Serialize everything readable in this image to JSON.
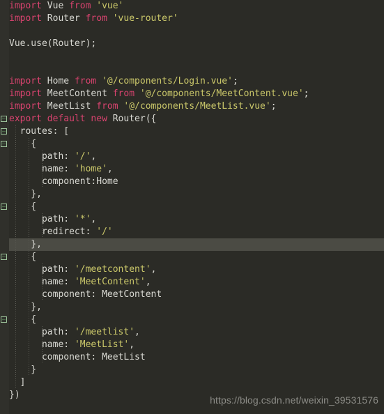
{
  "editor": {
    "background_color": "#2b2b26",
    "gutter_color": "#30302b",
    "current_line_color": "#4b4b44",
    "font_size_px": 13,
    "line_height_px": 18,
    "colors": {
      "keyword": "#d9436f",
      "identifier": "#d8d8d2",
      "string": "#cbc86a",
      "punctuation": "#d8d8d2",
      "fold_marker_border": "#9ec49b",
      "indent_guide": "#5c5c54"
    }
  },
  "watermark": {
    "text": "https://blog.csdn.net/weixin_39531576"
  },
  "current_line_number": 20,
  "fold_marker_lines": [
    10,
    11,
    12,
    17,
    21,
    26
  ],
  "code_lines": [
    {
      "n": 1,
      "indent_guides": [],
      "tokens": [
        {
          "t": "import",
          "c": "key"
        },
        {
          "t": " ",
          "c": "punc"
        },
        {
          "t": "Vue",
          "c": "id"
        },
        {
          "t": " ",
          "c": "punc"
        },
        {
          "t": "from",
          "c": "key"
        },
        {
          "t": " ",
          "c": "punc"
        },
        {
          "t": "'vue'",
          "c": "str"
        }
      ]
    },
    {
      "n": 2,
      "indent_guides": [],
      "tokens": [
        {
          "t": "import",
          "c": "key"
        },
        {
          "t": " ",
          "c": "punc"
        },
        {
          "t": "Router",
          "c": "id"
        },
        {
          "t": " ",
          "c": "punc"
        },
        {
          "t": "from",
          "c": "key"
        },
        {
          "t": " ",
          "c": "punc"
        },
        {
          "t": "'vue-router'",
          "c": "str"
        }
      ]
    },
    {
      "n": 3,
      "indent_guides": [],
      "tokens": []
    },
    {
      "n": 4,
      "indent_guides": [],
      "tokens": [
        {
          "t": "Vue.use(Router);",
          "c": "id"
        }
      ]
    },
    {
      "n": 5,
      "indent_guides": [],
      "tokens": []
    },
    {
      "n": 6,
      "indent_guides": [],
      "tokens": []
    },
    {
      "n": 7,
      "indent_guides": [],
      "tokens": [
        {
          "t": "import",
          "c": "key"
        },
        {
          "t": " ",
          "c": "punc"
        },
        {
          "t": "Home",
          "c": "id"
        },
        {
          "t": " ",
          "c": "punc"
        },
        {
          "t": "from",
          "c": "key"
        },
        {
          "t": " ",
          "c": "punc"
        },
        {
          "t": "'@/components/Login.vue'",
          "c": "str"
        },
        {
          "t": ";",
          "c": "punc"
        }
      ]
    },
    {
      "n": 8,
      "indent_guides": [],
      "tokens": [
        {
          "t": "import",
          "c": "key"
        },
        {
          "t": " ",
          "c": "punc"
        },
        {
          "t": "MeetContent",
          "c": "id"
        },
        {
          "t": " ",
          "c": "punc"
        },
        {
          "t": "from",
          "c": "key"
        },
        {
          "t": " ",
          "c": "punc"
        },
        {
          "t": "'@/components/MeetContent.vue'",
          "c": "str"
        },
        {
          "t": ";",
          "c": "punc"
        }
      ]
    },
    {
      "n": 9,
      "indent_guides": [],
      "tokens": [
        {
          "t": "import",
          "c": "key"
        },
        {
          "t": " ",
          "c": "punc"
        },
        {
          "t": "MeetList",
          "c": "id"
        },
        {
          "t": " ",
          "c": "punc"
        },
        {
          "t": "from",
          "c": "key"
        },
        {
          "t": " ",
          "c": "punc"
        },
        {
          "t": "'@/components/MeetList.vue'",
          "c": "str"
        },
        {
          "t": ";",
          "c": "punc"
        }
      ]
    },
    {
      "n": 10,
      "indent_guides": [],
      "tokens": [
        {
          "t": "export",
          "c": "key"
        },
        {
          "t": " ",
          "c": "punc"
        },
        {
          "t": "default",
          "c": "key"
        },
        {
          "t": " ",
          "c": "punc"
        },
        {
          "t": "new",
          "c": "key"
        },
        {
          "t": " ",
          "c": "punc"
        },
        {
          "t": "Router({",
          "c": "id"
        }
      ]
    },
    {
      "n": 11,
      "indent_guides": [
        22
      ],
      "tokens": [
        {
          "t": "  ",
          "c": "punc"
        },
        {
          "t": "routes",
          "c": "prop"
        },
        {
          "t": ": [",
          "c": "punc"
        }
      ]
    },
    {
      "n": 12,
      "indent_guides": [
        22,
        41
      ],
      "tokens": [
        {
          "t": "    {",
          "c": "punc"
        }
      ]
    },
    {
      "n": 13,
      "indent_guides": [
        22,
        41,
        60
      ],
      "tokens": [
        {
          "t": "      ",
          "c": "punc"
        },
        {
          "t": "path",
          "c": "prop"
        },
        {
          "t": ": ",
          "c": "punc"
        },
        {
          "t": "'/'",
          "c": "str"
        },
        {
          "t": ",",
          "c": "punc"
        }
      ]
    },
    {
      "n": 14,
      "indent_guides": [
        22,
        41,
        60
      ],
      "tokens": [
        {
          "t": "      ",
          "c": "punc"
        },
        {
          "t": "name",
          "c": "prop"
        },
        {
          "t": ": ",
          "c": "punc"
        },
        {
          "t": "'home'",
          "c": "str"
        },
        {
          "t": ",",
          "c": "punc"
        }
      ]
    },
    {
      "n": 15,
      "indent_guides": [
        22,
        41,
        60
      ],
      "tokens": [
        {
          "t": "      ",
          "c": "punc"
        },
        {
          "t": "component",
          "c": "prop"
        },
        {
          "t": ":",
          "c": "punc"
        },
        {
          "t": "Home",
          "c": "id"
        }
      ]
    },
    {
      "n": 16,
      "indent_guides": [
        22,
        41
      ],
      "tokens": [
        {
          "t": "    },",
          "c": "punc"
        }
      ]
    },
    {
      "n": 17,
      "indent_guides": [
        22,
        41
      ],
      "tokens": [
        {
          "t": "    {",
          "c": "punc"
        }
      ]
    },
    {
      "n": 18,
      "indent_guides": [
        22,
        41,
        60
      ],
      "tokens": [
        {
          "t": "      ",
          "c": "punc"
        },
        {
          "t": "path",
          "c": "prop"
        },
        {
          "t": ": ",
          "c": "punc"
        },
        {
          "t": "'*'",
          "c": "str"
        },
        {
          "t": ",",
          "c": "punc"
        }
      ]
    },
    {
      "n": 19,
      "indent_guides": [
        22,
        41,
        60
      ],
      "tokens": [
        {
          "t": "      ",
          "c": "punc"
        },
        {
          "t": "redirect",
          "c": "prop"
        },
        {
          "t": ": ",
          "c": "punc"
        },
        {
          "t": "'/'",
          "c": "str"
        }
      ]
    },
    {
      "n": 20,
      "indent_guides": [
        22,
        41
      ],
      "tokens": [
        {
          "t": "    },",
          "c": "punc"
        }
      ]
    },
    {
      "n": 21,
      "indent_guides": [
        22,
        41
      ],
      "tokens": [
        {
          "t": "    {",
          "c": "punc"
        }
      ]
    },
    {
      "n": 22,
      "indent_guides": [
        22,
        41,
        60
      ],
      "tokens": [
        {
          "t": "      ",
          "c": "punc"
        },
        {
          "t": "path",
          "c": "prop"
        },
        {
          "t": ": ",
          "c": "punc"
        },
        {
          "t": "'/meetcontent'",
          "c": "str"
        },
        {
          "t": ",",
          "c": "punc"
        }
      ]
    },
    {
      "n": 23,
      "indent_guides": [
        22,
        41,
        60
      ],
      "tokens": [
        {
          "t": "      ",
          "c": "punc"
        },
        {
          "t": "name",
          "c": "prop"
        },
        {
          "t": ": ",
          "c": "punc"
        },
        {
          "t": "'MeetContent'",
          "c": "str"
        },
        {
          "t": ",",
          "c": "punc"
        }
      ]
    },
    {
      "n": 24,
      "indent_guides": [
        22,
        41,
        60
      ],
      "tokens": [
        {
          "t": "      ",
          "c": "punc"
        },
        {
          "t": "component",
          "c": "prop"
        },
        {
          "t": ": ",
          "c": "punc"
        },
        {
          "t": "MeetContent",
          "c": "id"
        }
      ]
    },
    {
      "n": 25,
      "indent_guides": [
        22,
        41
      ],
      "tokens": [
        {
          "t": "    },",
          "c": "punc"
        }
      ]
    },
    {
      "n": 26,
      "indent_guides": [
        22,
        41
      ],
      "tokens": [
        {
          "t": "    {",
          "c": "punc"
        }
      ]
    },
    {
      "n": 27,
      "indent_guides": [
        22,
        41,
        60
      ],
      "tokens": [
        {
          "t": "      ",
          "c": "punc"
        },
        {
          "t": "path",
          "c": "prop"
        },
        {
          "t": ": ",
          "c": "punc"
        },
        {
          "t": "'/meetlist'",
          "c": "str"
        },
        {
          "t": ",",
          "c": "punc"
        }
      ]
    },
    {
      "n": 28,
      "indent_guides": [
        22,
        41,
        60
      ],
      "tokens": [
        {
          "t": "      ",
          "c": "punc"
        },
        {
          "t": "name",
          "c": "prop"
        },
        {
          "t": ": ",
          "c": "punc"
        },
        {
          "t": "'MeetList'",
          "c": "str"
        },
        {
          "t": ",",
          "c": "punc"
        }
      ]
    },
    {
      "n": 29,
      "indent_guides": [
        22,
        41,
        60
      ],
      "tokens": [
        {
          "t": "      ",
          "c": "punc"
        },
        {
          "t": "component",
          "c": "prop"
        },
        {
          "t": ": ",
          "c": "punc"
        },
        {
          "t": "MeetList",
          "c": "id"
        }
      ]
    },
    {
      "n": 30,
      "indent_guides": [
        22,
        41
      ],
      "tokens": [
        {
          "t": "    }",
          "c": "punc"
        }
      ]
    },
    {
      "n": 31,
      "indent_guides": [
        22
      ],
      "tokens": [
        {
          "t": "  ]",
          "c": "punc"
        }
      ]
    },
    {
      "n": 32,
      "indent_guides": [],
      "tokens": [
        {
          "t": "})",
          "c": "punc"
        }
      ]
    }
  ]
}
